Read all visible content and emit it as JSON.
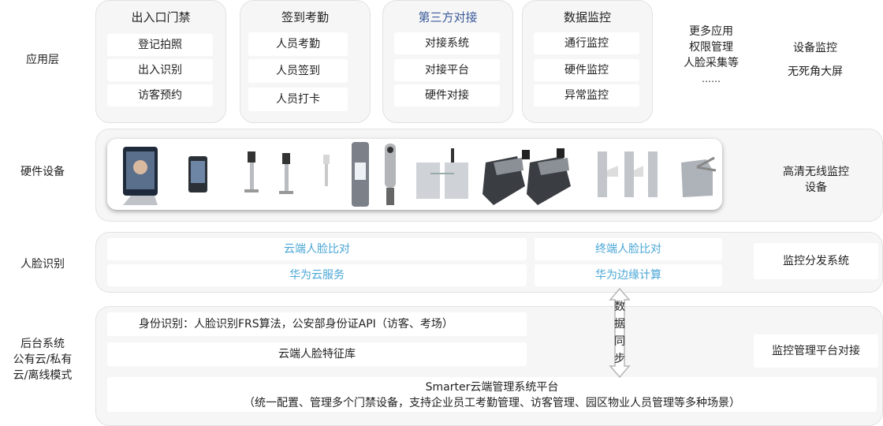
{
  "layers": {
    "app": "应用层",
    "hardware": "硬件设备",
    "face": "人脸识别",
    "backend": [
      "后台系统",
      "公有云/私有",
      "云/离线模式"
    ]
  },
  "app_columns": [
    {
      "title": "出入口门禁",
      "items": [
        "登记拍照",
        "出入识别",
        "访客预约"
      ]
    },
    {
      "title": "签到考勤",
      "items": [
        "人员考勤",
        "人员签到",
        "人员打卡"
      ]
    },
    {
      "title": "第三方对接",
      "items": [
        "对接系统",
        "对接平台",
        "硬件对接"
      ]
    },
    {
      "title": "数据监控",
      "items": [
        "通行监控",
        "硬件监控",
        "异常监控"
      ]
    }
  ],
  "more_apps": [
    "更多应用",
    "权限管理",
    "人脸采集等",
    "……"
  ],
  "device_monitor": [
    "设备监控",
    "无死角大屏"
  ],
  "hardware_side": [
    "高清无线监控",
    "设备"
  ],
  "face": {
    "cloud_compare": "云端人脸比对",
    "huawei_cloud": "华为云服务",
    "terminal_compare": "终端人脸比对",
    "huawei_edge": "华为边缘计算",
    "monitor_dispatch": "监控分发系统"
  },
  "backend": {
    "identity": "身份识别：人脸识别FRS算法，公安部身份证API（访客、考场）",
    "feature_db": "云端人脸特征库",
    "platform_title": "Smarter云端管理系统平台",
    "platform_desc": "（统一配置、管理多个门禁设备，支持企业员工考勤管理、访客管理、园区物业人员管理等多种场景）",
    "monitor_platform": "监控管理平台对接"
  },
  "sync_chars": [
    "数",
    "据",
    "同",
    "步"
  ],
  "colors": {
    "blue_text": "#49a6d6",
    "navy_text": "#3a5a9a",
    "panel_bg": "#f6f6f6"
  }
}
